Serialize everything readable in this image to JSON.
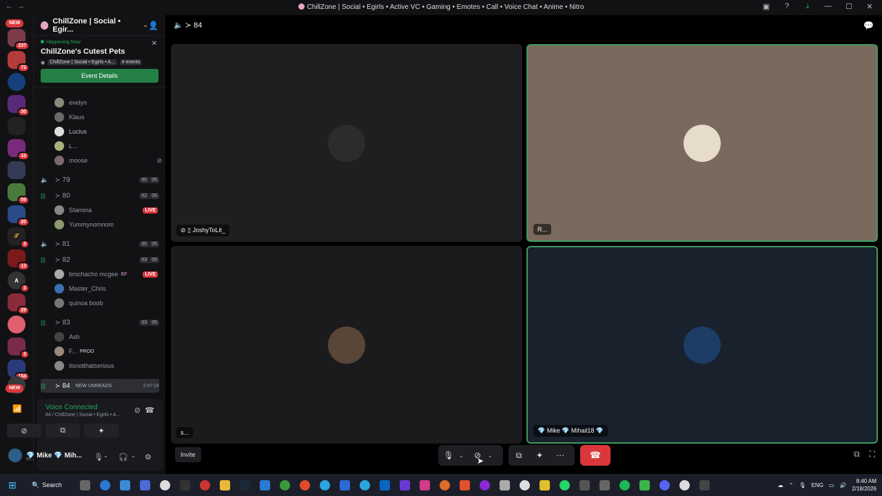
{
  "window": {
    "title": "ChillZone | Social • Egirls • Active VC • Gaming • Emotes • Call • Voice Chat • Anime • Nitro"
  },
  "rail": {
    "new_top": "NEW",
    "new_bottom": "NEW",
    "badges": [
      "237",
      "72",
      "30",
      "10",
      "59",
      "20",
      "3",
      "13",
      "3",
      "29",
      "3",
      "154"
    ]
  },
  "server": {
    "name": "ChillZone | Social • Egir..."
  },
  "event": {
    "status": "Happening Now",
    "name": "ChillZone's Cutest Pets",
    "location": "ChillZone | Social • Egirls • A...",
    "channel": "# events",
    "button": "Event Details"
  },
  "channels": {
    "users_top": [
      "evelyn",
      "Klaus",
      "Lucius",
      "L...",
      "moose"
    ],
    "vc79": {
      "name": "79",
      "count_a": "00",
      "count_b": "05"
    },
    "vc80": {
      "name": "80",
      "count_a": "02",
      "count_b": "05"
    },
    "vc80_users": [
      {
        "name": "Stamina",
        "live": "LIVE"
      },
      {
        "name": "Yummynomnom"
      }
    ],
    "vc81": {
      "name": "81",
      "count_a": "00",
      "count_b": "05"
    },
    "vc82": {
      "name": "82",
      "count_a": "03",
      "count_b": "05"
    },
    "vc82_users": [
      {
        "name": "brochacho mcgee",
        "role": "BF",
        "live": "LIVE"
      },
      {
        "name": "Master_Chris"
      },
      {
        "name": "quinoa boob"
      }
    ],
    "vc83": {
      "name": "83",
      "count_a": "03",
      "count_b": "05"
    },
    "vc83_users": [
      {
        "name": "Ash"
      },
      {
        "name": "F...",
        "tag": "PROO"
      },
      {
        "name": "itsnotthatserious"
      }
    ],
    "vc84": {
      "name": "84",
      "new_unreads": "NEW UNREADS",
      "time": "2:47:24"
    }
  },
  "voice_panel": {
    "status": "Voice Connected",
    "location": "84 / ChillZone | Social • Egirls • A...",
    "user_name": "💎 Mike 💎 Mih...",
    "user_status": "m..."
  },
  "main": {
    "channel": "84",
    "tiles": [
      {
        "label": "JoshyToLit_",
        "bg": "#1f1f21",
        "avatar": "#2c2c2e"
      },
      {
        "label": "R...",
        "bg": "#7a6a5d",
        "avatar": "#e7dccc"
      },
      {
        "label": "s...",
        "bg": "#1b1b1d",
        "avatar": "#5a4638"
      },
      {
        "label": "💎 Mike 💎 Mihail18 💎",
        "bg": "#19212c",
        "avatar": "#1d3c66"
      }
    ],
    "invite": "Invite"
  },
  "taskbar": {
    "search": "Search",
    "lang": "ENG",
    "time": "8:40 AM",
    "date": "2/18/2026"
  },
  "colors": {
    "accent_green": "#23a55a",
    "danger": "#da373c",
    "speaking_border": "#3c9c5f"
  }
}
